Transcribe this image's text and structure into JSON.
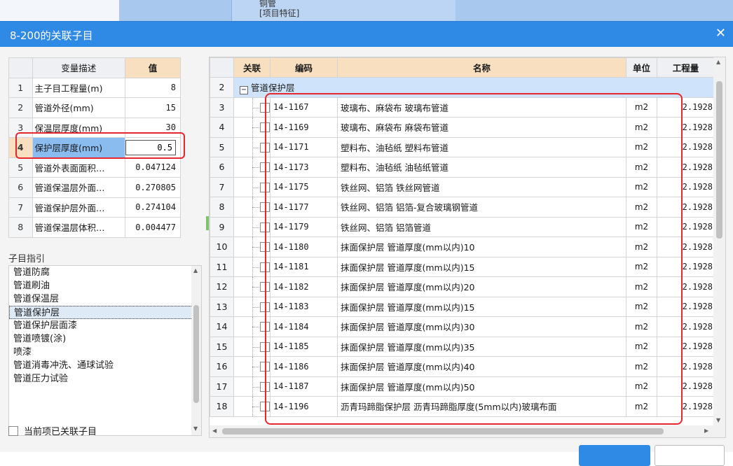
{
  "background": {
    "line1": "铜管",
    "line2": "[项目特征]"
  },
  "dialog": {
    "title": "8-200的关联子目",
    "close_icon": "close-icon"
  },
  "variables": {
    "headers": {
      "num": "",
      "desc": "变量描述",
      "value": "值"
    },
    "rows": [
      {
        "num": "1",
        "desc": "主子目工程量(m)",
        "value": "8"
      },
      {
        "num": "2",
        "desc": "管道外径(mm)",
        "value": "15"
      },
      {
        "num": "3",
        "desc": "保温层厚度(mm)",
        "value": "30"
      },
      {
        "num": "4",
        "desc": "保护层厚度(mm)",
        "value": "0.5"
      },
      {
        "num": "5",
        "desc": "管道外表面面积…",
        "value": "0.047124"
      },
      {
        "num": "6",
        "desc": "管道保温层外面…",
        "value": "0.270805"
      },
      {
        "num": "7",
        "desc": "管道保护层外面…",
        "value": "0.274104"
      },
      {
        "num": "8",
        "desc": "管道保温层体积…",
        "value": "0.004477"
      }
    ]
  },
  "subitems": {
    "title": "子目指引",
    "items": [
      "管道防腐",
      "管道刷油",
      "管道保温层",
      "管道保护层",
      "管道保护层面漆",
      "管道喷镀(涂)",
      "喷漆",
      "管道消毒冲洗、通球试验",
      "管道压力试验"
    ],
    "selected_index": 3
  },
  "checkbox_label": "当前项已关联子目",
  "grid": {
    "headers": {
      "num": "",
      "link": "关联",
      "code": "编码",
      "name": "名称",
      "unit": "单位",
      "qty": "工程量"
    },
    "group": {
      "num": "2",
      "name": "管道保护层"
    },
    "rows": [
      {
        "num": "3",
        "code": "14-1167",
        "name": "玻璃布、麻袋布 玻璃布管道",
        "unit": "m2",
        "qty": "2.1928"
      },
      {
        "num": "4",
        "code": "14-1169",
        "name": "玻璃布、麻袋布 麻袋布管道",
        "unit": "m2",
        "qty": "2.1928"
      },
      {
        "num": "5",
        "code": "14-1171",
        "name": "塑料布、油毡纸 塑料布管道",
        "unit": "m2",
        "qty": "2.1928"
      },
      {
        "num": "6",
        "code": "14-1173",
        "name": "塑料布、油毡纸 油毡纸管道",
        "unit": "m2",
        "qty": "2.1928"
      },
      {
        "num": "7",
        "code": "14-1175",
        "name": "铁丝网、铝箔 铁丝网管道",
        "unit": "m2",
        "qty": "2.1928"
      },
      {
        "num": "8",
        "code": "14-1177",
        "name": "铁丝网、铝箔 铝箔-复合玻璃钢管道",
        "unit": "m2",
        "qty": "2.1928"
      },
      {
        "num": "9",
        "code": "14-1179",
        "name": "铁丝网、铝箔 铝箔管道",
        "unit": "m2",
        "qty": "2.1928"
      },
      {
        "num": "10",
        "code": "14-1180",
        "name": "抹面保护层 管道厚度(mm以内)10",
        "unit": "m2",
        "qty": "2.1928"
      },
      {
        "num": "11",
        "code": "14-1181",
        "name": "抹面保护层 管道厚度(mm以内)15",
        "unit": "m2",
        "qty": "2.1928"
      },
      {
        "num": "12",
        "code": "14-1182",
        "name": "抹面保护层 管道厚度(mm以内)20",
        "unit": "m2",
        "qty": "2.1928"
      },
      {
        "num": "13",
        "code": "14-1183",
        "name": "抹面保护层 管道厚度(mm以内)15",
        "unit": "m2",
        "qty": "2.1928"
      },
      {
        "num": "14",
        "code": "14-1184",
        "name": "抹面保护层 管道厚度(mm以内)30",
        "unit": "m2",
        "qty": "2.1928"
      },
      {
        "num": "15",
        "code": "14-1185",
        "name": "抹面保护层 管道厚度(mm以内)35",
        "unit": "m2",
        "qty": "2.1928"
      },
      {
        "num": "16",
        "code": "14-1186",
        "name": "抹面保护层 管道厚度(mm以内)40",
        "unit": "m2",
        "qty": "2.1928"
      },
      {
        "num": "17",
        "code": "14-1187",
        "name": "抹面保护层 管道厚度(mm以内)50",
        "unit": "m2",
        "qty": "2.1928"
      },
      {
        "num": "18",
        "code": "14-1196",
        "name": "沥青玛蹄脂保护层 沥青玛蹄脂厚度(5mm以内)玻璃布面",
        "unit": "m2",
        "qty": "2.1928"
      }
    ]
  },
  "colors": {
    "accent": "#2f8ae6",
    "highlight": "#e8262d",
    "header_accent": "#f7dfc0",
    "selected": "#8bbcf0"
  }
}
